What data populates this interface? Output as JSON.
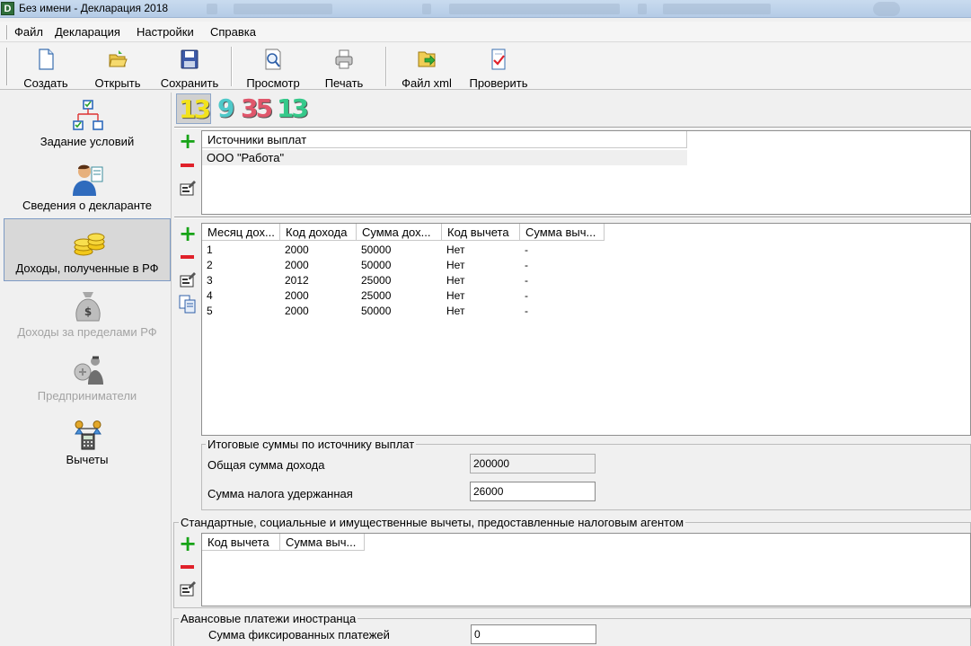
{
  "window": {
    "title": "Без имени - Декларация 2018",
    "icon_letter": "D"
  },
  "menu": [
    "Файл",
    "Декларация",
    "Настройки",
    "Справка"
  ],
  "toolbar": {
    "create": "Создать",
    "open": "Открыть",
    "save": "Сохранить",
    "preview": "Просмотр",
    "print": "Печать",
    "xml": "Файл xml",
    "check": "Проверить"
  },
  "sidebar": {
    "items": [
      {
        "label": "Задание условий",
        "icon": "org-chart-icon",
        "state": "normal"
      },
      {
        "label": "Сведения о декларанте",
        "icon": "person-icon",
        "state": "normal"
      },
      {
        "label": "Доходы, полученные в РФ",
        "icon": "coins-icon",
        "state": "selected"
      },
      {
        "label": "Доходы за пределами РФ",
        "icon": "money-bag-icon",
        "state": "disabled"
      },
      {
        "label": "Предприниматели",
        "icon": "businessman-icon",
        "state": "disabled"
      },
      {
        "label": "Вычеты",
        "icon": "scales-calculator-icon",
        "state": "normal"
      }
    ]
  },
  "rate_tabs": [
    {
      "label": "13",
      "color": "#f2e21c",
      "active": true
    },
    {
      "label": "9",
      "color": "#4fc9c9",
      "active": false
    },
    {
      "label": "35",
      "color": "#e0566b",
      "active": false
    },
    {
      "label": "13",
      "color": "#35c98a",
      "active": false
    }
  ],
  "sources": {
    "header": "Источники выплат",
    "rows": [
      "ООО \"Работа\""
    ]
  },
  "incomes": {
    "columns": [
      "Месяц дох...",
      "Код дохода",
      "Сумма дох...",
      "Код вычета",
      "Сумма выч..."
    ],
    "rows": [
      [
        "1",
        "2000",
        "50000",
        "Нет",
        "-"
      ],
      [
        "2",
        "2000",
        "50000",
        "Нет",
        "-"
      ],
      [
        "3",
        "2012",
        "25000",
        "Нет",
        "-"
      ],
      [
        "4",
        "2000",
        "25000",
        "Нет",
        "-"
      ],
      [
        "5",
        "2000",
        "50000",
        "Нет",
        "-"
      ]
    ]
  },
  "totals": {
    "title": "Итоговые суммы по источнику выплат",
    "income_label": "Общая сумма дохода",
    "income_value": "200000",
    "tax_label": "Сумма налога удержанная",
    "tax_value": "26000"
  },
  "deductions": {
    "title": "Стандартные, социальные и имущественные вычеты, предоставленные налоговым агентом",
    "columns": [
      "Код вычета",
      "Сумма выч..."
    ]
  },
  "advance": {
    "title": "Авансовые платежи иностранца",
    "label": "Сумма фиксированных платежей",
    "value": "0"
  }
}
